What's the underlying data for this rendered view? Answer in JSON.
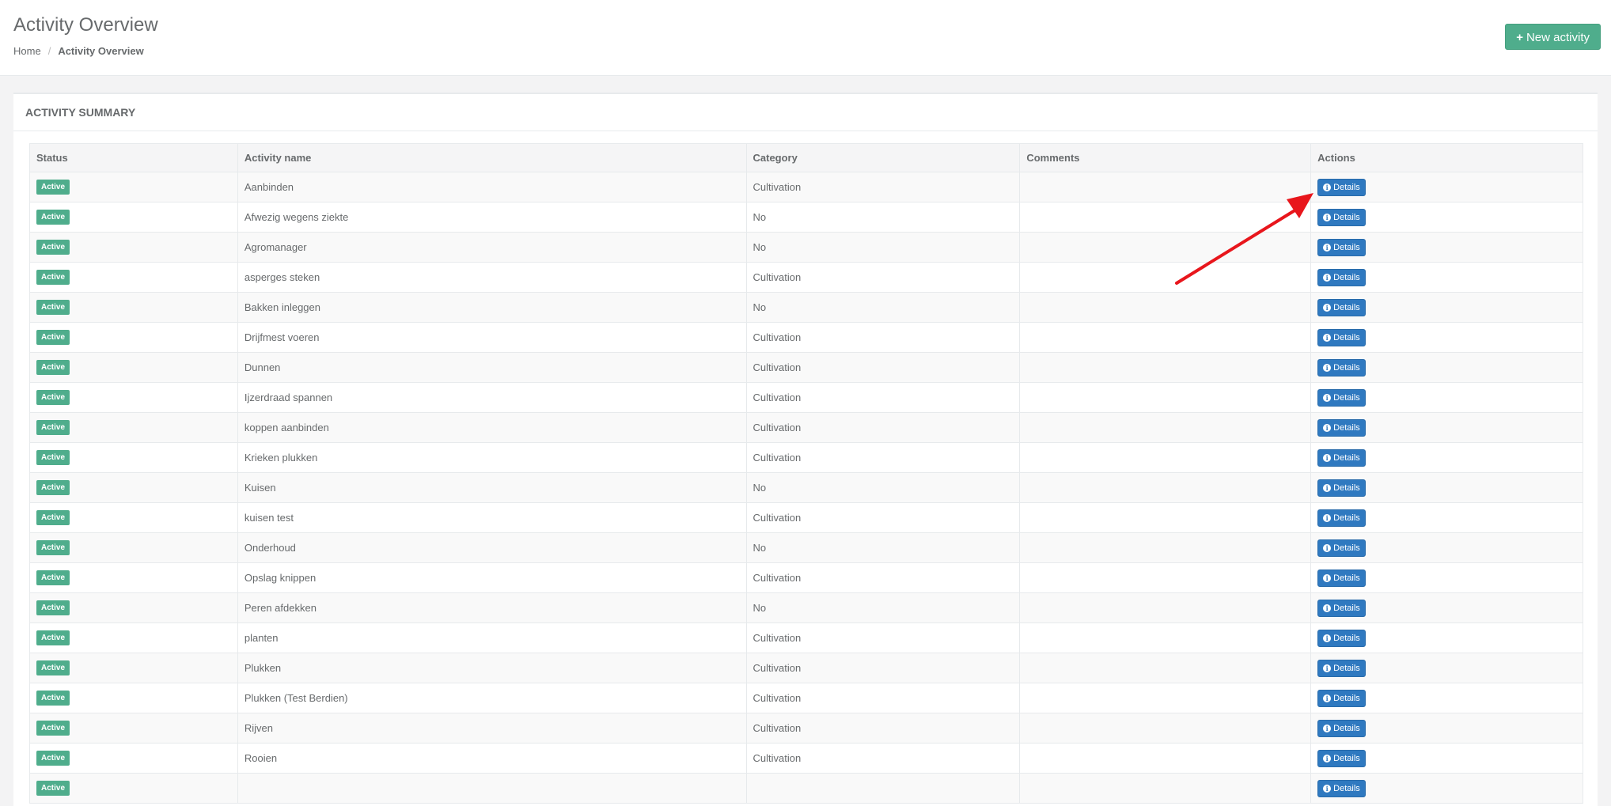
{
  "header": {
    "title": "Activity Overview",
    "breadcrumb": [
      "Home",
      "Activity Overview"
    ],
    "new_button_label": "New activity"
  },
  "panel": {
    "title": "ACTIVITY SUMMARY"
  },
  "table": {
    "columns": [
      "Status",
      "Activity name",
      "Category",
      "Comments",
      "Actions"
    ],
    "rows": [
      {
        "status": "Active",
        "name": "Aanbinden",
        "category": "Cultivation",
        "comments": "",
        "action": "Details"
      },
      {
        "status": "Active",
        "name": "Afwezig wegens ziekte",
        "category": "No",
        "comments": "",
        "action": "Details"
      },
      {
        "status": "Active",
        "name": "Agromanager",
        "category": "No",
        "comments": "",
        "action": "Details"
      },
      {
        "status": "Active",
        "name": "asperges steken",
        "category": "Cultivation",
        "comments": "",
        "action": "Details"
      },
      {
        "status": "Active",
        "name": "Bakken inleggen",
        "category": "No",
        "comments": "",
        "action": "Details"
      },
      {
        "status": "Active",
        "name": "Drijfmest voeren",
        "category": "Cultivation",
        "comments": "",
        "action": "Details"
      },
      {
        "status": "Active",
        "name": "Dunnen",
        "category": "Cultivation",
        "comments": "",
        "action": "Details"
      },
      {
        "status": "Active",
        "name": "Ijzerdraad spannen",
        "category": "Cultivation",
        "comments": "",
        "action": "Details"
      },
      {
        "status": "Active",
        "name": "koppen aanbinden",
        "category": "Cultivation",
        "comments": "",
        "action": "Details"
      },
      {
        "status": "Active",
        "name": "Krieken plukken",
        "category": "Cultivation",
        "comments": "",
        "action": "Details"
      },
      {
        "status": "Active",
        "name": "Kuisen",
        "category": "No",
        "comments": "",
        "action": "Details"
      },
      {
        "status": "Active",
        "name": "kuisen test",
        "category": "Cultivation",
        "comments": "",
        "action": "Details"
      },
      {
        "status": "Active",
        "name": "Onderhoud",
        "category": "No",
        "comments": "",
        "action": "Details"
      },
      {
        "status": "Active",
        "name": "Opslag knippen",
        "category": "Cultivation",
        "comments": "",
        "action": "Details"
      },
      {
        "status": "Active",
        "name": "Peren afdekken",
        "category": "No",
        "comments": "",
        "action": "Details"
      },
      {
        "status": "Active",
        "name": "planten",
        "category": "Cultivation",
        "comments": "",
        "action": "Details"
      },
      {
        "status": "Active",
        "name": "Plukken",
        "category": "Cultivation",
        "comments": "",
        "action": "Details"
      },
      {
        "status": "Active",
        "name": "Plukken (Test Berdien)",
        "category": "Cultivation",
        "comments": "",
        "action": "Details"
      },
      {
        "status": "Active",
        "name": "Rijven",
        "category": "Cultivation",
        "comments": "",
        "action": "Details"
      },
      {
        "status": "Active",
        "name": "Rooien",
        "category": "Cultivation",
        "comments": "",
        "action": "Details"
      },
      {
        "status": "Active",
        "name": "",
        "category": "",
        "comments": "",
        "action": "Details"
      }
    ]
  },
  "colors": {
    "active_badge": "#4fad8c",
    "details_button": "#2f79c0",
    "new_button": "#4fad8c",
    "annotation_arrow": "#e8161c"
  },
  "icons": {
    "new_button_icon": "plus-icon",
    "details_icon": "info-circle-icon"
  }
}
